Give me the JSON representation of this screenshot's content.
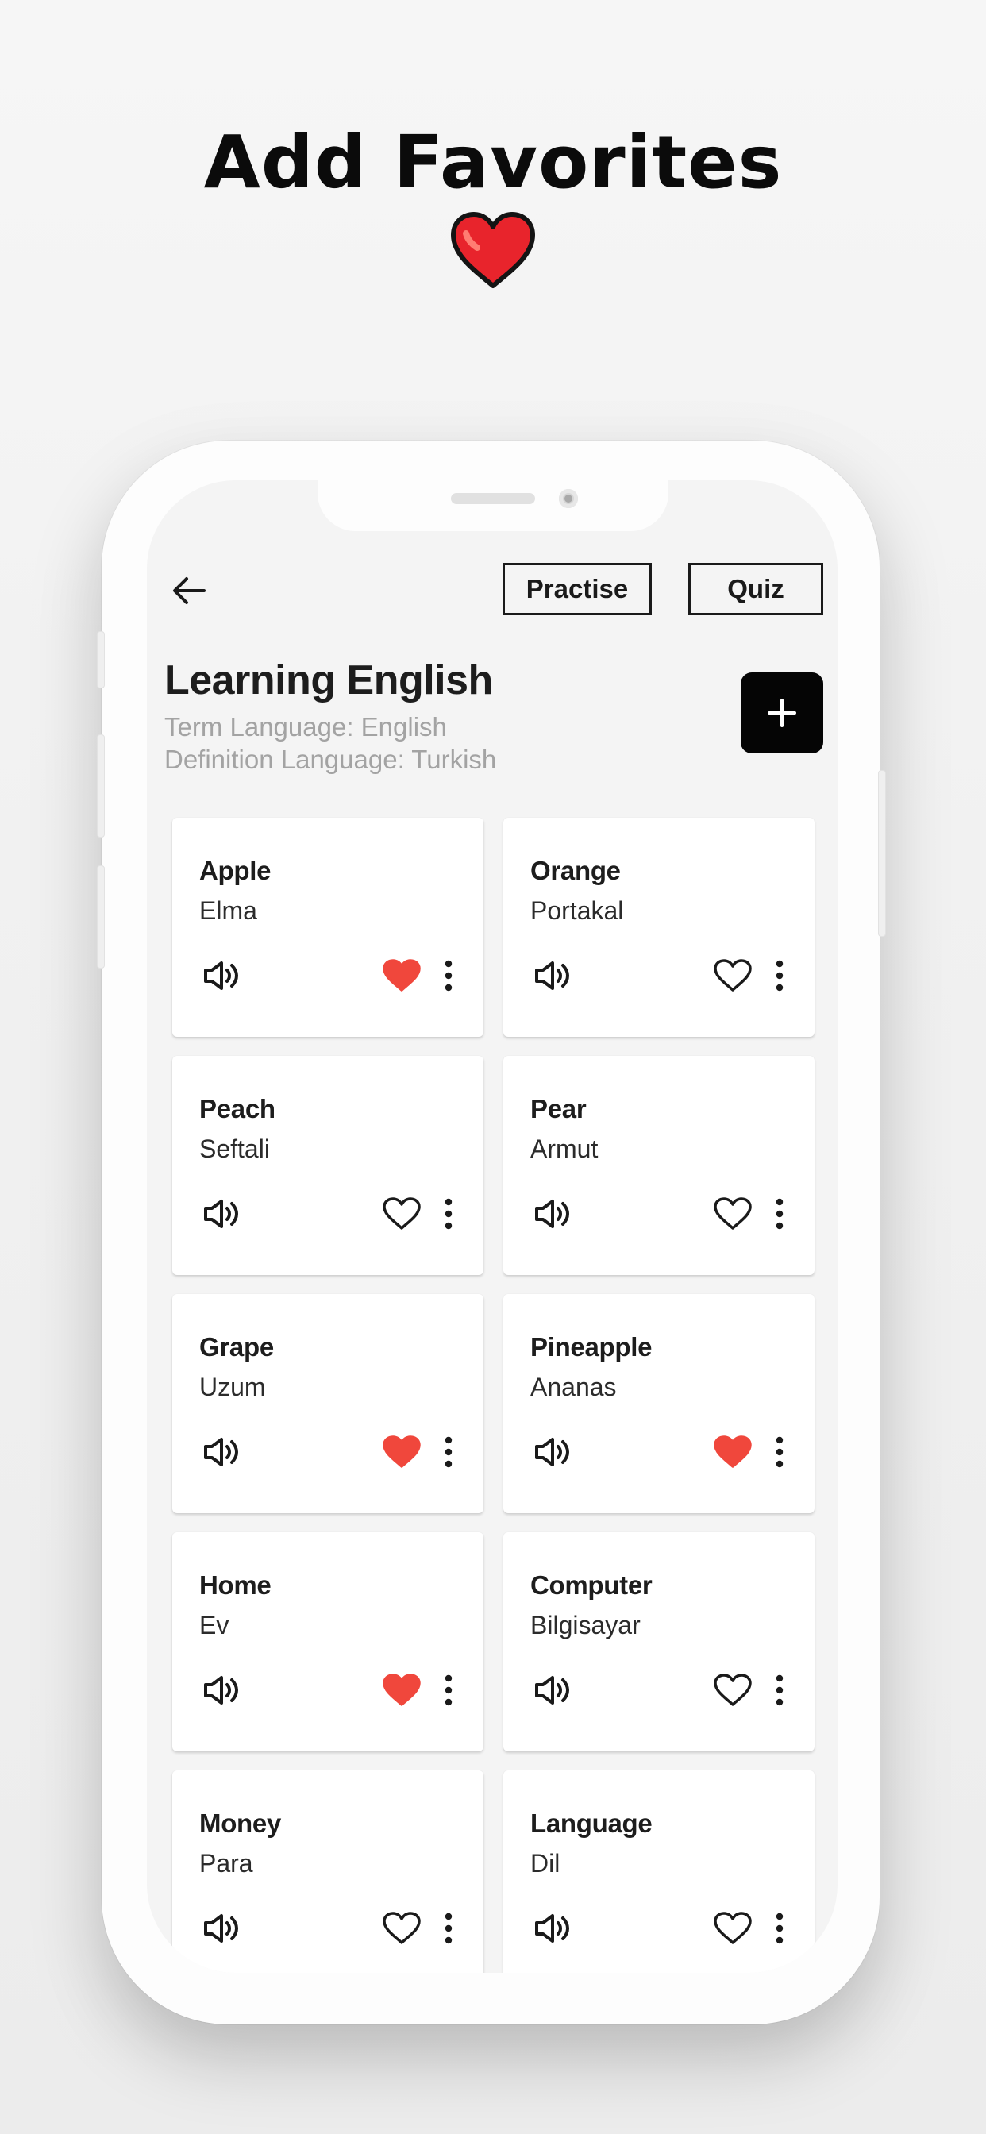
{
  "promo": {
    "title": "Add Favorites",
    "heart_color": "#e8242c"
  },
  "app_bar": {
    "back_icon": "arrow-left-icon",
    "practise_label": "Practise",
    "quiz_label": "Quiz"
  },
  "header": {
    "title": "Learning English",
    "term_language": "Term Language: English",
    "definition_language": "Definition Language: Turkish",
    "add_icon": "plus-icon"
  },
  "colors": {
    "favorite_active": "#f0473c",
    "icon_dark": "#1a1a1a",
    "muted_text": "#a3a3a3"
  },
  "cards": [
    {
      "term": "Apple",
      "definition": "Elma",
      "favorite": true
    },
    {
      "term": "Orange",
      "definition": "Portakal",
      "favorite": false
    },
    {
      "term": "Peach",
      "definition": "Seftali",
      "favorite": false
    },
    {
      "term": "Pear",
      "definition": "Armut",
      "favorite": false
    },
    {
      "term": "Grape",
      "definition": "Uzum",
      "favorite": true
    },
    {
      "term": "Pineapple",
      "definition": "Ananas",
      "favorite": true
    },
    {
      "term": "Home",
      "definition": "Ev",
      "favorite": true
    },
    {
      "term": "Computer",
      "definition": "Bilgisayar",
      "favorite": false
    },
    {
      "term": "Money",
      "definition": "Para",
      "favorite": false
    },
    {
      "term": "Language",
      "definition": "Dil",
      "favorite": false
    }
  ]
}
